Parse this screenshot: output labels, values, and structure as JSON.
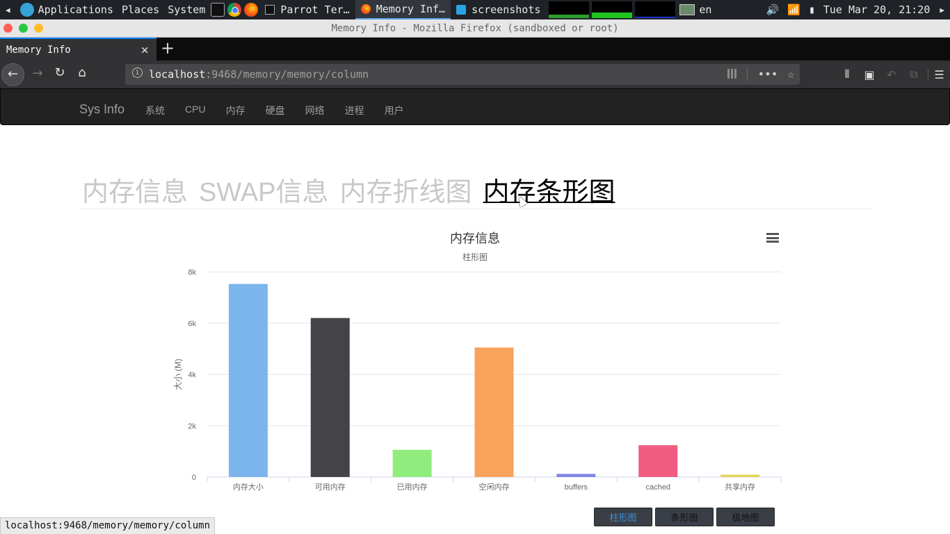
{
  "system_panel": {
    "menus": [
      "Applications",
      "Places",
      "System"
    ],
    "tasks": [
      {
        "label": "Parrot Ter…"
      },
      {
        "label": "Memory Inf…"
      },
      {
        "label": "screenshots"
      }
    ],
    "keyboard_layout": "en",
    "clock": "Tue Mar 20, 21:20"
  },
  "window": {
    "title": "Memory Info - Mozilla Firefox (sandboxed or root)"
  },
  "browser": {
    "tab_title": "Memory Info",
    "tab_close": "×",
    "new_tab": "+",
    "url_host": "localhost",
    "url_rest": ":9468/memory/memory/column",
    "status_url": "localhost:9468/memory/memory/column"
  },
  "site": {
    "brand": "Sys Info",
    "nav": [
      "系统",
      "CPU",
      "内存",
      "硬盘",
      "网络",
      "进程",
      "用户"
    ],
    "tabs": [
      "内存信息",
      "SWAP信息",
      "内存折线图",
      "内存条形图"
    ],
    "active_tab": 3,
    "buttons": [
      "柱形图",
      "条形图",
      "极地图"
    ],
    "active_button": 0
  },
  "chart_data": {
    "type": "bar",
    "title": "内存信息",
    "subtitle": "柱形图",
    "ylabel": "大小 (M)",
    "ylim": [
      0,
      8000
    ],
    "yticks": [
      "0",
      "2k",
      "4k",
      "6k",
      "8k"
    ],
    "categories": [
      "内存大小",
      "可用内存",
      "已用内存",
      "空闲内存",
      "buffers",
      "cached",
      "共享内存"
    ],
    "values": [
      7530,
      6200,
      1060,
      5050,
      120,
      1240,
      90
    ],
    "colors": [
      "#7cb5ec",
      "#434348",
      "#90ed7d",
      "#f7a35c",
      "#8085e9",
      "#f15c80",
      "#e4d354"
    ],
    "grid": true,
    "legend": false
  }
}
